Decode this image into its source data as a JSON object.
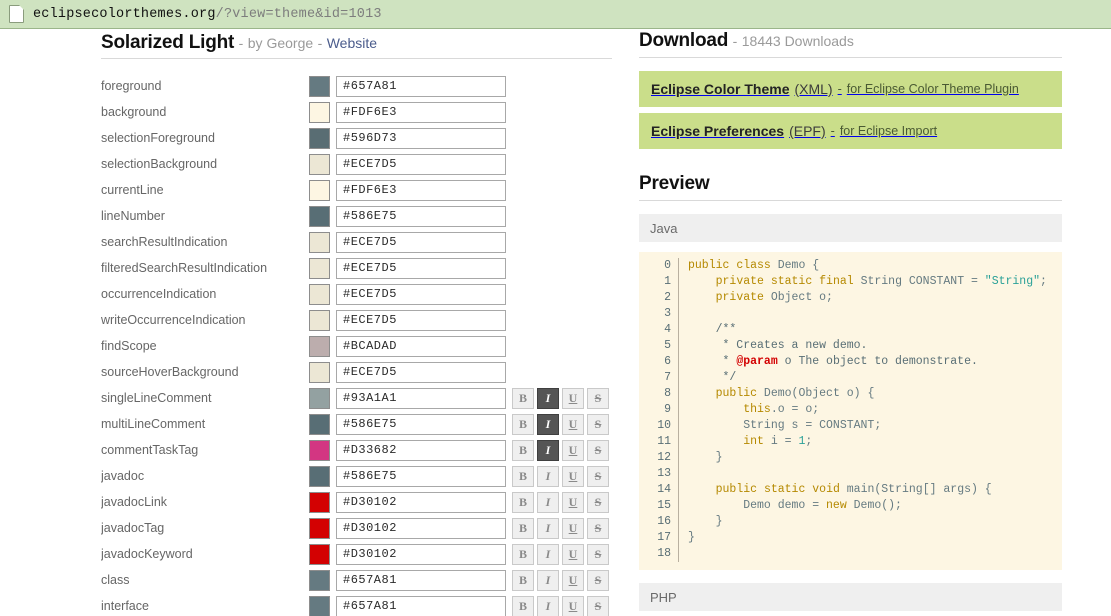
{
  "browser": {
    "tab_icon": "page-icon",
    "url_host": "eclipsecolorthemes.org",
    "url_query": "/?view=theme&id=1013"
  },
  "theme": {
    "name": "Solarized Light",
    "dash1": "-",
    "by": "by George",
    "dash2": "-",
    "website_label": "Website"
  },
  "color_rows": [
    {
      "label": "foreground",
      "hex": "#657A81",
      "styles": false
    },
    {
      "label": "background",
      "hex": "#FDF6E3",
      "styles": false
    },
    {
      "label": "selectionForeground",
      "hex": "#596D73",
      "styles": false
    },
    {
      "label": "selectionBackground",
      "hex": "#ECE7D5",
      "styles": false
    },
    {
      "label": "currentLine",
      "hex": "#FDF6E3",
      "styles": false
    },
    {
      "label": "lineNumber",
      "hex": "#586E75",
      "styles": false
    },
    {
      "label": "searchResultIndication",
      "hex": "#ECE7D5",
      "styles": false
    },
    {
      "label": "filteredSearchResultIndication",
      "hex": "#ECE7D5",
      "styles": false
    },
    {
      "label": "occurrenceIndication",
      "hex": "#ECE7D5",
      "styles": false
    },
    {
      "label": "writeOccurrenceIndication",
      "hex": "#ECE7D5",
      "styles": false
    },
    {
      "label": "findScope",
      "hex": "#BCADAD",
      "styles": false
    },
    {
      "label": "sourceHoverBackground",
      "hex": "#ECE7D5",
      "styles": false
    },
    {
      "label": "singleLineComment",
      "hex": "#93A1A1",
      "styles": true,
      "bold": false,
      "italic": true,
      "underline": false,
      "strike": false
    },
    {
      "label": "multiLineComment",
      "hex": "#586E75",
      "styles": true,
      "bold": false,
      "italic": true,
      "underline": false,
      "strike": false
    },
    {
      "label": "commentTaskTag",
      "hex": "#D33682",
      "styles": true,
      "bold": false,
      "italic": true,
      "underline": false,
      "strike": false
    },
    {
      "label": "javadoc",
      "hex": "#586E75",
      "styles": true,
      "bold": false,
      "italic": false,
      "underline": false,
      "strike": false
    },
    {
      "label": "javadocLink",
      "hex": "#D30102",
      "styles": true,
      "bold": false,
      "italic": false,
      "underline": false,
      "strike": false
    },
    {
      "label": "javadocTag",
      "hex": "#D30102",
      "styles": true,
      "bold": false,
      "italic": false,
      "underline": false,
      "strike": false
    },
    {
      "label": "javadocKeyword",
      "hex": "#D30102",
      "styles": true,
      "bold": false,
      "italic": false,
      "underline": false,
      "strike": false
    },
    {
      "label": "class",
      "hex": "#657A81",
      "styles": true,
      "bold": false,
      "italic": false,
      "underline": false,
      "strike": false
    },
    {
      "label": "interface",
      "hex": "#657A81",
      "styles": true,
      "bold": false,
      "italic": false,
      "underline": false,
      "strike": false
    }
  ],
  "style_buttons": {
    "bold": "B",
    "italic": "I",
    "underline": "U",
    "strike": "S"
  },
  "download": {
    "title": "Download",
    "dash": "-",
    "count_text": "18443 Downloads",
    "buttons": [
      {
        "strong": "Eclipse Color Theme",
        "format": "(XML)",
        "dash": "-",
        "note": "for Eclipse Color Theme Plugin"
      },
      {
        "strong": "Eclipse Preferences",
        "format": "(EPF)",
        "dash": "-",
        "note": "for Eclipse Import"
      }
    ]
  },
  "preview": {
    "title": "Preview",
    "languages": [
      {
        "name": "Java"
      },
      {
        "name": "PHP"
      }
    ],
    "java": {
      "line_numbers": "0\n1\n2\n3\n4\n5\n6\n7\n8\n9\n10\n11\n12\n13\n14\n15\n16\n17\n18",
      "lines": [
        "public class Demo {",
        "    private static final String CONSTANT = \"String\";",
        "    private Object o;",
        "",
        "    /**",
        "     * Creates a new demo.",
        "     * @param o The object to demonstrate.",
        "     */",
        "    public Demo(Object o) {",
        "        this.o = o;",
        "        String s = CONSTANT;",
        "        int i = 1;",
        "    }",
        "",
        "    public static void main(String[] args) {",
        "        Demo demo = new Demo();",
        "    }",
        "}",
        ""
      ]
    }
  },
  "colors": {
    "tab_bg": "#cfe3c0",
    "download_btn": "#cade8a",
    "code_bg": "#FDF6E3",
    "lang_bar": "#efefef",
    "keyword": "#B58900",
    "string": "#2AA198",
    "comment": "#586E75",
    "javadoc_tag": "#D30102",
    "default_text": "#657A81"
  }
}
